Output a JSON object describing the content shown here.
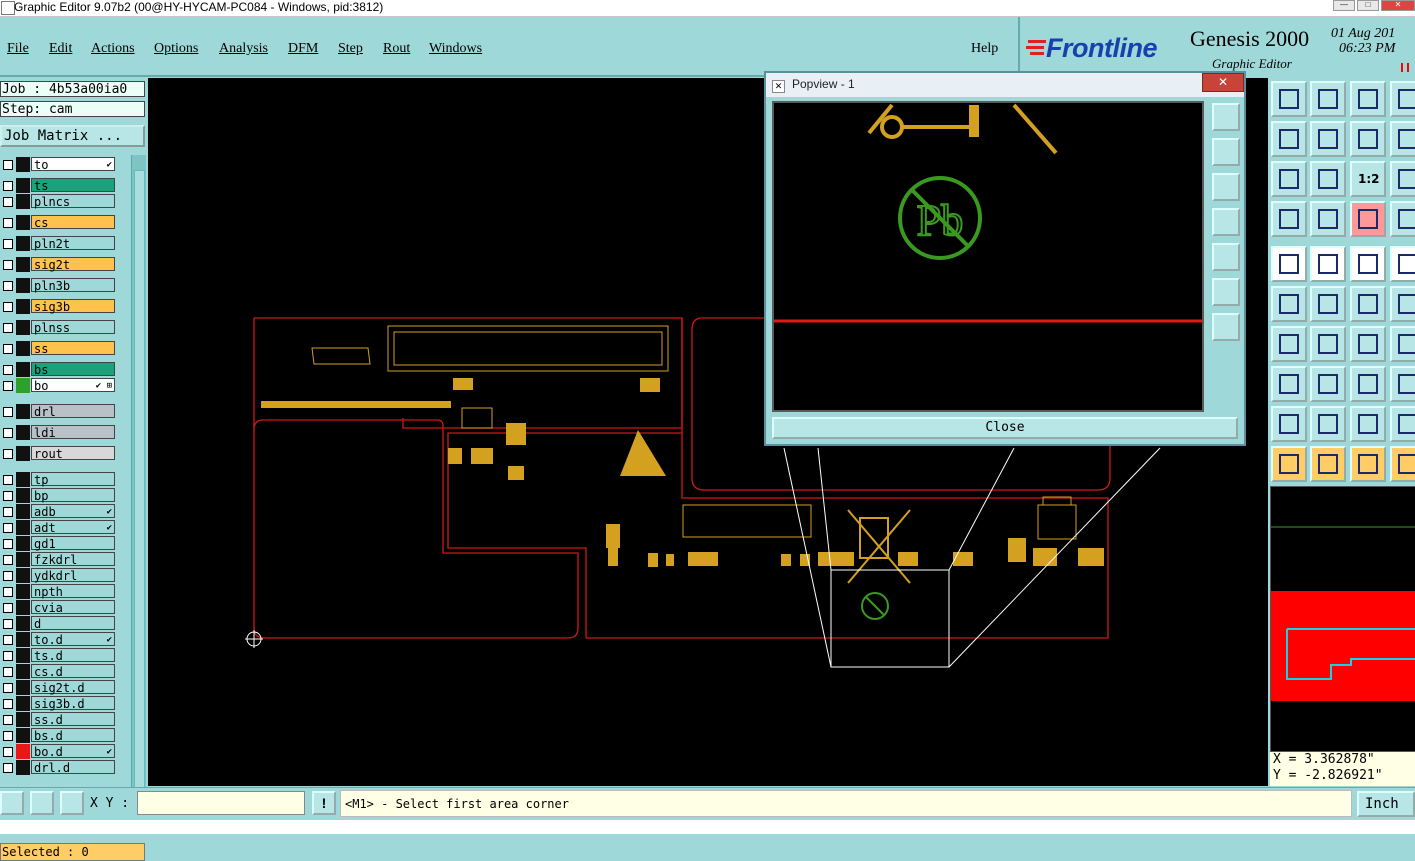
{
  "window": {
    "title": "Graphic Editor 9.07b2 (00@HY-HYCAM-PC084 - Windows, pid:3812)"
  },
  "menu": {
    "items": [
      "File",
      "Edit",
      "Actions",
      "Options",
      "Analysis",
      "DFM",
      "Step",
      "Rout",
      "Windows"
    ],
    "help": "Help"
  },
  "brand": {
    "logo": "Frontline",
    "product": "Genesis 2000",
    "subtitle": "Graphic Editor",
    "date": "01 Aug 201",
    "time": "06:23 PM"
  },
  "job": {
    "job_label": "Job : 4b53a00ia0",
    "step_label": "Step: cam",
    "matrix_button": "Job Matrix ..."
  },
  "layers": [
    {
      "name": "to",
      "bg": "#ffffff",
      "swatch": "#111111",
      "mark": "✔"
    },
    {
      "name": "ts",
      "bg": "#1aa37a",
      "swatch": "#111111",
      "mark": ""
    },
    {
      "name": "plncs",
      "bg": "#9fd8d8",
      "swatch": "#111111",
      "mark": ""
    },
    {
      "name": "cs",
      "bg": "#ffc34d",
      "swatch": "#111111",
      "mark": ""
    },
    {
      "name": "pln2t",
      "bg": "#9fd8d8",
      "swatch": "#111111",
      "mark": ""
    },
    {
      "name": "sig2t",
      "bg": "#ffc34d",
      "swatch": "#111111",
      "mark": ""
    },
    {
      "name": "pln3b",
      "bg": "#9fd8d8",
      "swatch": "#111111",
      "mark": ""
    },
    {
      "name": "sig3b",
      "bg": "#ffc34d",
      "swatch": "#111111",
      "mark": ""
    },
    {
      "name": "plnss",
      "bg": "#9fd8d8",
      "swatch": "#111111",
      "mark": ""
    },
    {
      "name": "ss",
      "bg": "#ffc34d",
      "swatch": "#111111",
      "mark": ""
    },
    {
      "name": "bs",
      "bg": "#1aa37a",
      "swatch": "#111111",
      "mark": ""
    },
    {
      "name": "bo",
      "bg": "#ffffff",
      "swatch": "#2ea02e",
      "mark": "✔ ⊞"
    },
    {
      "name": "drl",
      "bg": "#b8c0c8",
      "swatch": "#111111",
      "mark": ""
    },
    {
      "name": "ldi",
      "bg": "#b8c0c8",
      "swatch": "#111111",
      "mark": ""
    },
    {
      "name": "rout",
      "bg": "#d8d8d8",
      "swatch": "#111111",
      "mark": ""
    },
    {
      "name": "tp",
      "bg": "#9fd8d8",
      "swatch": "#111111",
      "mark": ""
    },
    {
      "name": "bp",
      "bg": "#9fd8d8",
      "swatch": "#111111",
      "mark": ""
    },
    {
      "name": "adb",
      "bg": "#9fd8d8",
      "swatch": "#111111",
      "mark": "✔"
    },
    {
      "name": "adt",
      "bg": "#9fd8d8",
      "swatch": "#111111",
      "mark": "✔"
    },
    {
      "name": "gd1",
      "bg": "#9fd8d8",
      "swatch": "#111111",
      "mark": ""
    },
    {
      "name": "fzkdrl",
      "bg": "#9fd8d8",
      "swatch": "#111111",
      "mark": ""
    },
    {
      "name": "ydkdrl",
      "bg": "#9fd8d8",
      "swatch": "#111111",
      "mark": ""
    },
    {
      "name": "npth",
      "bg": "#9fd8d8",
      "swatch": "#111111",
      "mark": ""
    },
    {
      "name": "cvia",
      "bg": "#9fd8d8",
      "swatch": "#111111",
      "mark": ""
    },
    {
      "name": "d",
      "bg": "#9fd8d8",
      "swatch": "#111111",
      "mark": ""
    },
    {
      "name": "to.d",
      "bg": "#9fd8d8",
      "swatch": "#111111",
      "mark": "✔"
    },
    {
      "name": "ts.d",
      "bg": "#9fd8d8",
      "swatch": "#111111",
      "mark": ""
    },
    {
      "name": "cs.d",
      "bg": "#9fd8d8",
      "swatch": "#111111",
      "mark": ""
    },
    {
      "name": "sig2t.d",
      "bg": "#9fd8d8",
      "swatch": "#111111",
      "mark": ""
    },
    {
      "name": "sig3b.d",
      "bg": "#9fd8d8",
      "swatch": "#111111",
      "mark": ""
    },
    {
      "name": "ss.d",
      "bg": "#9fd8d8",
      "swatch": "#111111",
      "mark": ""
    },
    {
      "name": "bs.d",
      "bg": "#9fd8d8",
      "swatch": "#111111",
      "mark": ""
    },
    {
      "name": "bo.d",
      "bg": "#9fd8d8",
      "swatch": "#e81818",
      "mark": "✔"
    },
    {
      "name": "drl.d",
      "bg": "#9fd8d8",
      "swatch": "#111111",
      "mark": ""
    }
  ],
  "selected": "Selected : 0",
  "popview": {
    "title": "Popview - 1",
    "close_button": "Close",
    "x_glyph": "✕",
    "pb_text": "Pb"
  },
  "coords": {
    "x": "X = 3.362878\"",
    "y": "Y = -2.826921\""
  },
  "bottom": {
    "xy_label": "X Y :",
    "prompt": "<M1> - Select first area corner",
    "units": "Inch",
    "xy_value": ""
  },
  "colors": {
    "panel": "#9fd8d8",
    "outline": "#d01818",
    "component": "#d4a020",
    "pb_logo": "#3a9a20",
    "highlight": "#ffcc66"
  },
  "toolbar_icons": [
    "home-icon",
    "save-icon",
    "house-icon",
    "frame-icon",
    "left-icon",
    "right-icon",
    "swap-icon",
    "question-icon",
    "fit-icon",
    "zoom-icon",
    "ratio-icon",
    "help-icon",
    "ruler-icon",
    "grid-icon",
    "measure-icon",
    "layers-icon",
    "pad-icon",
    "corner-icon",
    "scale-icon",
    "dot-icon",
    "connect-icon",
    "move-icon",
    "rotate-icon",
    "flip-icon",
    "line-icon",
    "slope-icon",
    "undo-icon",
    "mirror-icon",
    "clip-icon",
    "split-icon",
    "break-icon",
    "tool-icon",
    "poly-icon",
    "path-icon",
    "arc-icon",
    "shape-icon",
    "pointer-icon",
    "select-icon",
    "edit-icon",
    "trace-icon"
  ],
  "ratio_label": "1:2"
}
